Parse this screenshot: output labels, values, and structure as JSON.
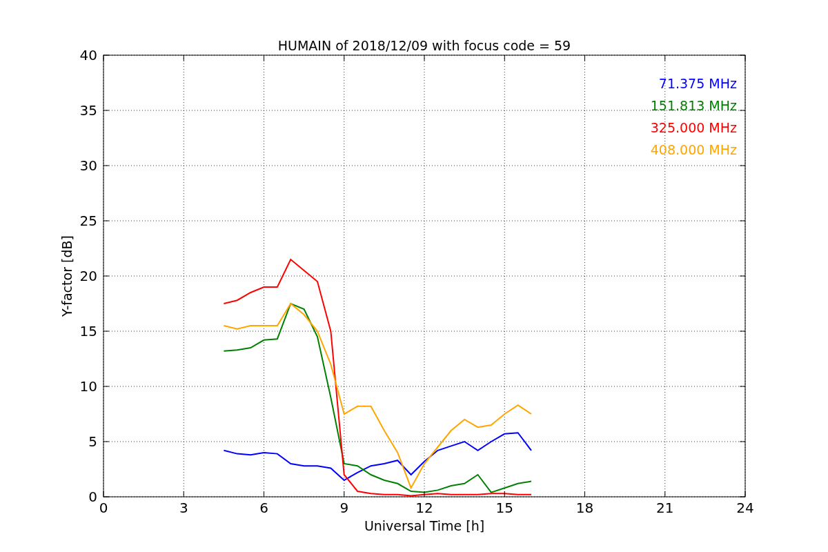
{
  "chart_data": {
    "type": "line",
    "title": "HUMAIN of 2018/12/09 with focus code = 59",
    "xlabel": "Universal Time [h]",
    "ylabel": "Y-factor [dB]",
    "x": [
      4.5,
      5,
      5.5,
      6,
      6.5,
      7,
      7.5,
      8,
      8.5,
      9,
      9.5,
      10,
      10.5,
      11,
      11.5,
      12,
      12.5,
      13,
      13.5,
      14,
      14.5,
      15,
      15.5,
      16
    ],
    "series": [
      {
        "name": "71.375 MHz",
        "color": "#0000ff",
        "values": [
          4.2,
          3.9,
          3.8,
          4.0,
          3.9,
          3.0,
          2.8,
          2.8,
          2.6,
          1.5,
          2.2,
          2.8,
          3.0,
          3.3,
          2.0,
          3.2,
          4.2,
          4.6,
          5.0,
          4.2,
          5.0,
          5.7,
          5.8,
          4.2
        ]
      },
      {
        "name": "151.813 MHz",
        "color": "#008000",
        "values": [
          13.2,
          13.3,
          13.5,
          14.2,
          14.3,
          17.5,
          17.0,
          14.5,
          9.0,
          3.0,
          2.8,
          2.0,
          1.5,
          1.2,
          0.5,
          0.4,
          0.6,
          1.0,
          1.2,
          2.0,
          0.4,
          0.8,
          1.2,
          1.4
        ]
      },
      {
        "name": "325.000 MHz",
        "color": "#ff0000",
        "values": [
          17.5,
          17.8,
          18.5,
          19.0,
          19.0,
          21.5,
          20.5,
          19.5,
          15.0,
          2.0,
          0.5,
          0.3,
          0.2,
          0.2,
          0.1,
          0.2,
          0.3,
          0.2,
          0.2,
          0.2,
          0.3,
          0.3,
          0.2,
          0.2
        ]
      },
      {
        "name": "408.000 MHz",
        "color": "#ffa500",
        "values": [
          15.5,
          15.2,
          15.5,
          15.5,
          15.5,
          17.5,
          16.5,
          15.0,
          12.0,
          7.5,
          8.2,
          8.2,
          6.0,
          4.0,
          0.8,
          3.0,
          4.5,
          6.0,
          7.0,
          6.3,
          6.5,
          7.5,
          8.3,
          7.5
        ]
      }
    ],
    "grid": true,
    "xlim": [
      0,
      24
    ],
    "ylim": [
      0,
      40
    ],
    "xticks": [
      0,
      3,
      6,
      9,
      12,
      15,
      18,
      21,
      24
    ],
    "yticks": [
      0,
      5,
      10,
      15,
      20,
      25,
      30,
      35,
      40
    ]
  }
}
